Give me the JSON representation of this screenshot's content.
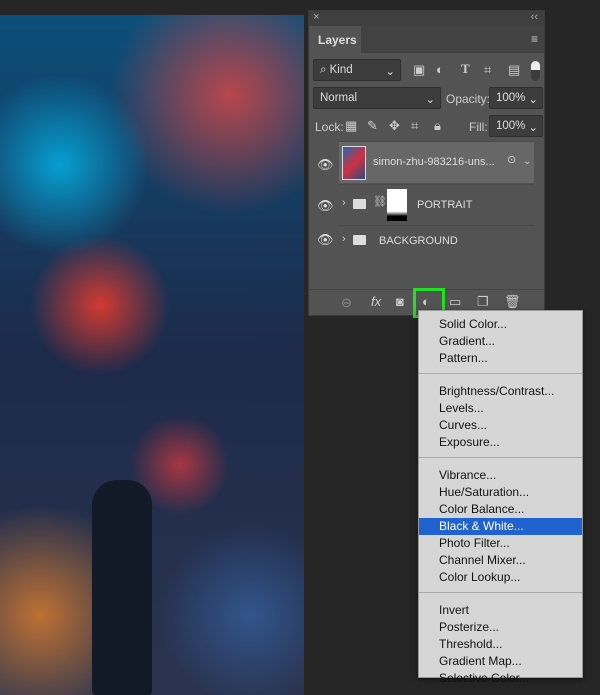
{
  "panel": {
    "title": "Layers",
    "filter_kind": "Kind",
    "blend_mode": "Normal",
    "opacity_label": "Opacity:",
    "opacity": "100%",
    "lock_label": "Lock:",
    "fill_label": "Fill:",
    "fill": "100%"
  },
  "layers": [
    {
      "name": "simon-zhu-983216-uns...",
      "type": "smart-object",
      "selected": true
    },
    {
      "name": "PORTRAIT",
      "type": "group-with-mask"
    },
    {
      "name": "BACKGROUND",
      "type": "group"
    }
  ],
  "menu": {
    "groups": [
      [
        "Solid Color...",
        "Gradient...",
        "Pattern..."
      ],
      [
        "Brightness/Contrast...",
        "Levels...",
        "Curves...",
        "Exposure..."
      ],
      [
        "Vibrance...",
        "Hue/Saturation...",
        "Color Balance...",
        "Black & White...",
        "Photo Filter...",
        "Channel Mixer...",
        "Color Lookup..."
      ],
      [
        "Invert",
        "Posterize...",
        "Threshold...",
        "Gradient Map...",
        "Selective Color..."
      ]
    ],
    "highlighted": "Black & White..."
  },
  "colors": {
    "highlight_outline": "#22e022",
    "menu_selection": "#1f62d0"
  }
}
